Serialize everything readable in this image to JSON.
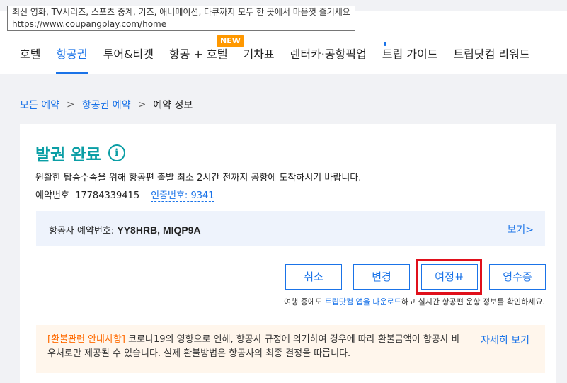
{
  "tooltip": {
    "line1": "최신 영화, TV시리즈, 스포츠 중계, 키즈, 애니메이션, 다큐까지 모두 한 곳에서 마음껏 즐기세요",
    "line2": "https://www.coupangplay.com/home"
  },
  "nav": {
    "items": [
      {
        "label": "호텔"
      },
      {
        "label": "항공권"
      },
      {
        "label": "투어&티켓"
      },
      {
        "label": "항공 + 호텔"
      },
      {
        "label": "기차표"
      },
      {
        "label": "렌터카·공항픽업"
      },
      {
        "label": "트립 가이드"
      },
      {
        "label": "트립닷컴 리워드"
      }
    ],
    "active_index": 1,
    "new_badge": "NEW"
  },
  "breadcrumb": {
    "items": [
      "모든 예약",
      "항공권 예약",
      "예약 정보"
    ],
    "separator": ">"
  },
  "booking": {
    "title": "발권 완료",
    "info_icon": "i",
    "notice": "원활한 탑승수속을 위해 항공편 출발 최소 2시간 전까지 공항에 도착하시기 바랍니다.",
    "reservation_label": "예약번호",
    "reservation_number": "17784339415",
    "auth_code": "인증번호: 9341",
    "airline_label": "항공사 예약번호:",
    "airline_codes": "YY8HRB, MIQP9A",
    "view_label": "보기",
    "view_arrow": ">"
  },
  "buttons": {
    "cancel": "취소",
    "change": "변경",
    "itinerary": "여정표",
    "receipt": "영수증"
  },
  "app_hint": {
    "prefix": "여행 중에도 ",
    "link": "트립닷컴 앱을 다운로드",
    "suffix": "하고 실시간 항공편 운항 정보를 확인하세요."
  },
  "refund": {
    "tag": "[환불관련 안내사항]",
    "text": " 코로나19의 영향으로 인해, 항공사 규정에 의거하여 경우에 따라 환불금액이 항공사 바우처로만 제공될 수 있습니다. 실제 환불방법은 항공사의 최종 결정을 따릅니다.",
    "more": "자세히 보기"
  },
  "colors": {
    "accent": "#1a73e8",
    "title": "#0a9ea5",
    "highlight": "#e0101b",
    "badge": "#ff9800",
    "refund_tag": "#ff6a00"
  }
}
